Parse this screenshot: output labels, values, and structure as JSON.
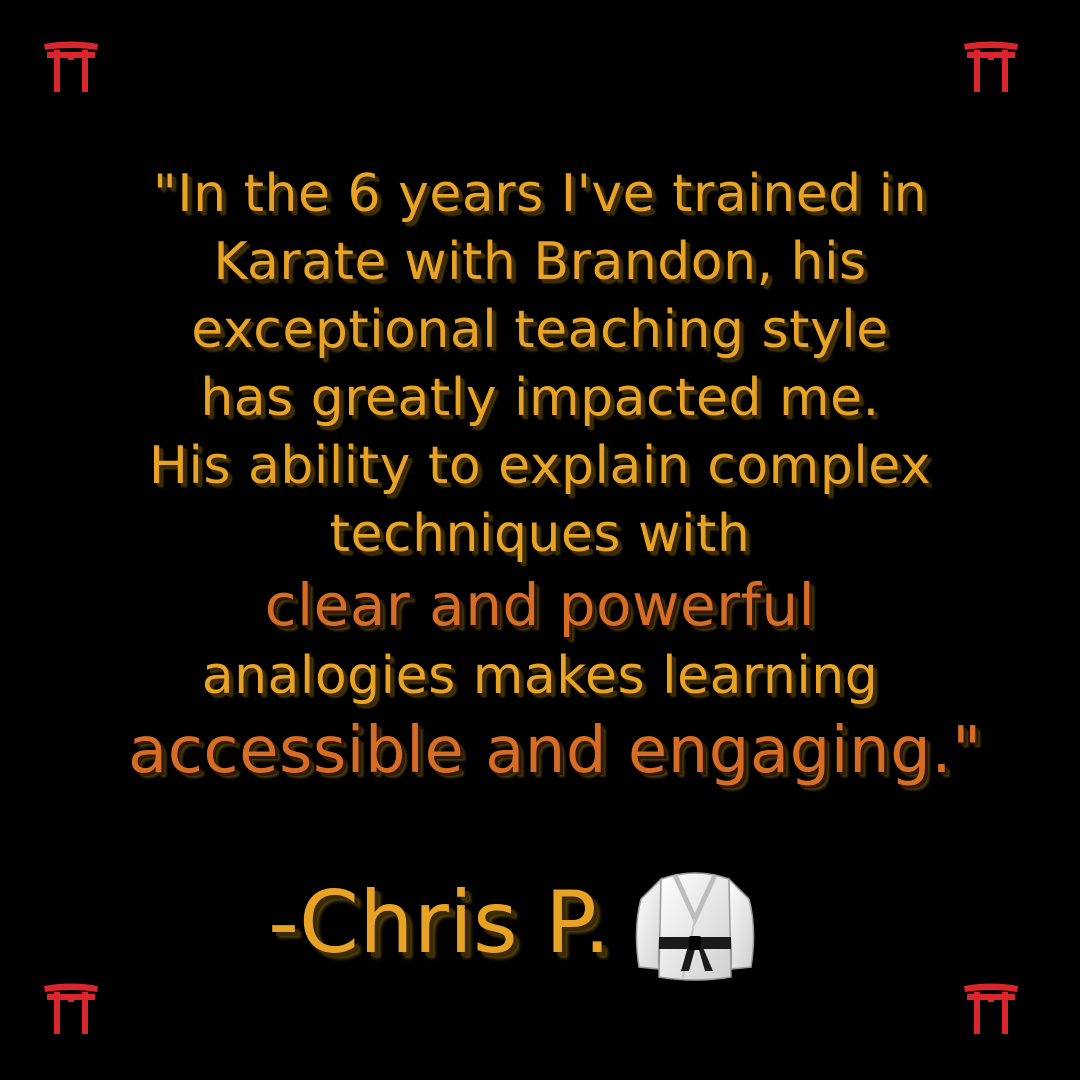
{
  "quote": {
    "line1": "\"In the 6 years I've trained in",
    "line2": "Karate with Brandon, his",
    "line3": "exceptional teaching style",
    "line4": "has greatly impacted me.",
    "line5": "His ability to explain complex",
    "line6": "techniques with",
    "line7": "clear and powerful",
    "line8": "analogies makes learning",
    "line9": "accessible and engaging.\""
  },
  "signature": {
    "name": "-Chris P."
  },
  "icons": {
    "corner": "torii-gate-icon",
    "emoji": "martial-arts-uniform-icon"
  },
  "colors": {
    "background": "#000000",
    "gold": "#E8A325",
    "orange": "#D76C24",
    "torii_red": "#D8262C"
  }
}
